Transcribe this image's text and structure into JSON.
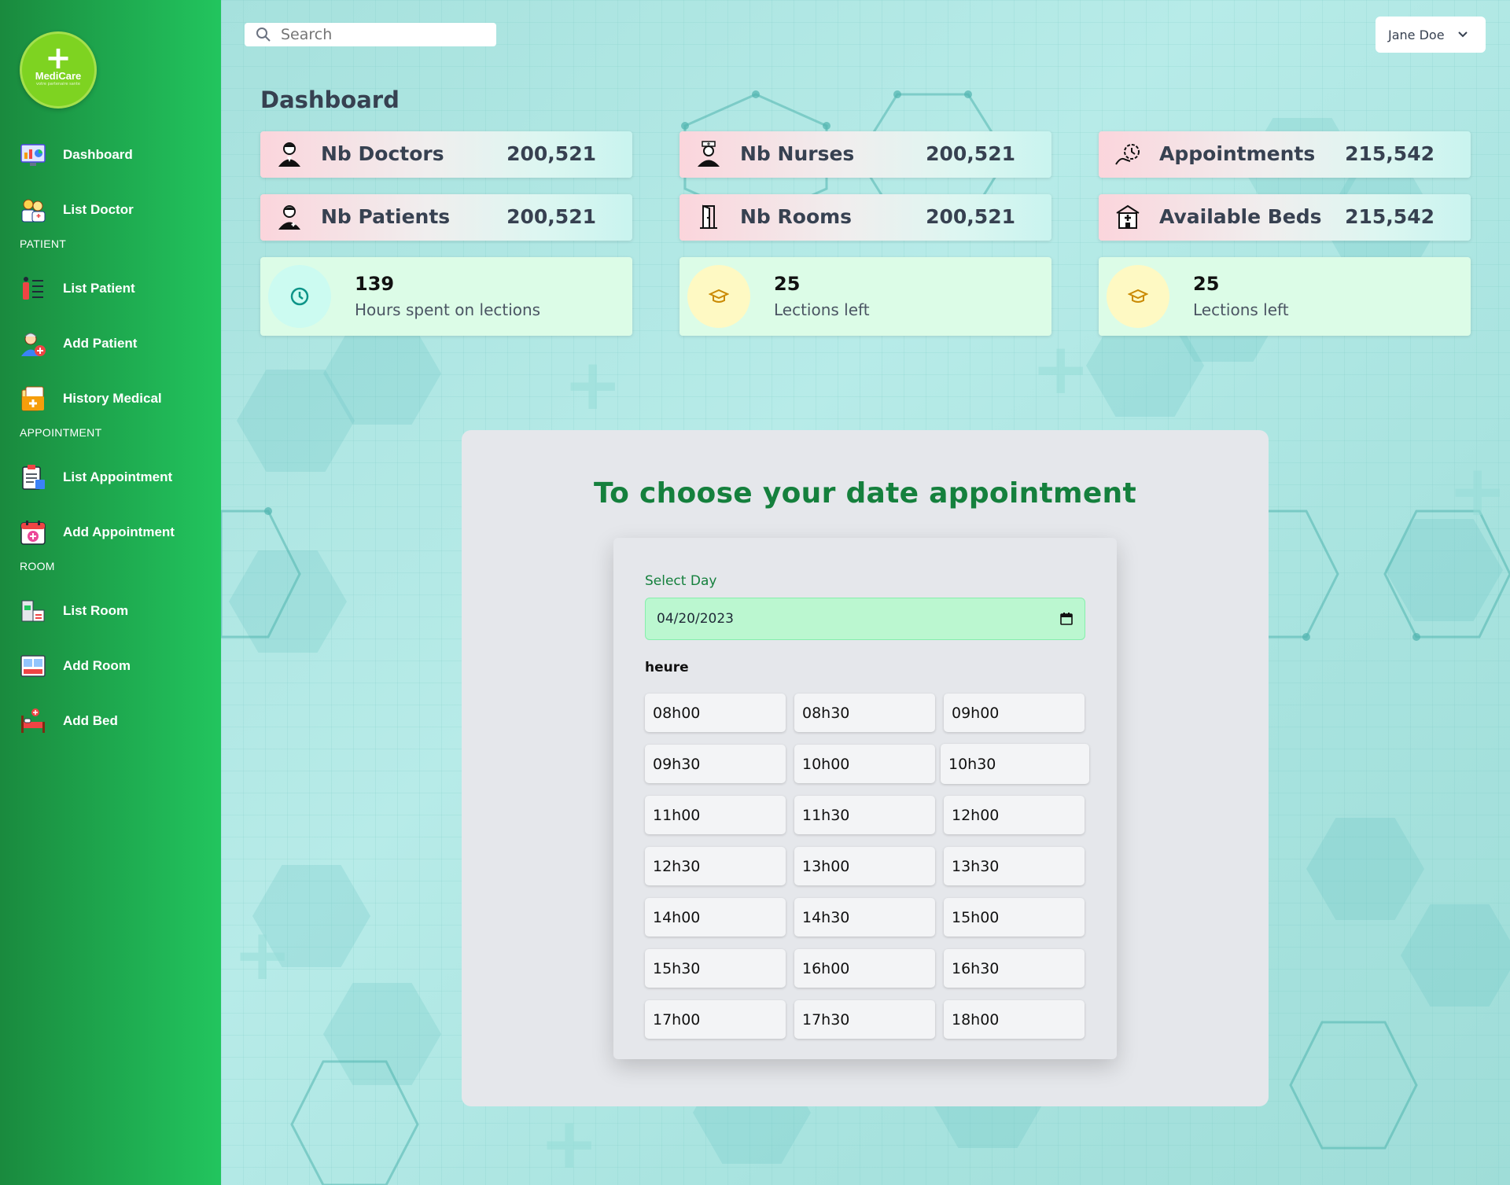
{
  "app": {
    "logo_name": "MediCare",
    "logo_tagline": "votre partenaire sante"
  },
  "sidebar": {
    "items": [
      {
        "label": "Dashboard",
        "icon": "dashboard-icon"
      },
      {
        "label": "List Doctor",
        "icon": "doctors-icon"
      },
      {
        "section": "PATIENT"
      },
      {
        "label": "List Patient",
        "icon": "list-patient-icon"
      },
      {
        "label": "Add Patient",
        "icon": "add-patient-icon"
      },
      {
        "label": "History Medical",
        "icon": "medical-folder-icon"
      },
      {
        "section": "APPOINTMENT"
      },
      {
        "label": "List Appointment",
        "icon": "clipboard-icon"
      },
      {
        "label": "Add Appointment",
        "icon": "calendar-add-icon"
      },
      {
        "section": "ROOM"
      },
      {
        "label": "List Room",
        "icon": "room-icon"
      },
      {
        "label": "Add Room",
        "icon": "add-room-icon"
      },
      {
        "label": "Add Bed",
        "icon": "bed-icon"
      }
    ]
  },
  "header": {
    "search_placeholder": "Search",
    "user_name": "Jane Doe"
  },
  "page_title": "Dashboard",
  "stats": [
    {
      "label": "Nb Doctors",
      "value": "200,521",
      "icon": "doctor-icon"
    },
    {
      "label": "Nb Nurses",
      "value": "200,521",
      "icon": "nurse-icon"
    },
    {
      "label": "Appointments",
      "value": "215,542",
      "icon": "appointment-icon"
    },
    {
      "label": "Nb Patients",
      "value": "200,521",
      "icon": "patient-icon"
    },
    {
      "label": "Nb Rooms",
      "value": "200,521",
      "icon": "door-icon"
    },
    {
      "label": "Available Beds",
      "value": "215,542",
      "icon": "hospital-icon"
    }
  ],
  "info_cards": [
    {
      "number": "139",
      "text": "Hours spent on lections",
      "icon": "clock-icon",
      "color": "#ccfbf1"
    },
    {
      "number": "25",
      "text": "Lections left",
      "icon": "graduation-cap-icon",
      "color": "#fef9c3"
    },
    {
      "number": "25",
      "text": "Lections left",
      "icon": "graduation-cap-icon",
      "color": "#fef9c3"
    }
  ],
  "appointment": {
    "title": "To choose your date appointment",
    "day_label": "Select Day",
    "date_value": "04/20/2023",
    "hour_label": "heure",
    "slots": [
      "08h00",
      "08h30",
      "09h00",
      "09h30",
      "10h00",
      "10h30",
      "11h00",
      "11h30",
      "12h00",
      "12h30",
      "13h00",
      "13h30",
      "14h00",
      "14h30",
      "15h00",
      "15h30",
      "16h00",
      "16h30",
      "17h00",
      "17h30",
      "18h00"
    ],
    "highlighted_slot": "10h30"
  },
  "colors": {
    "sidebar_dark": "#1a8a3e",
    "sidebar_light": "#22c55e",
    "accent_green": "#15803d",
    "date_bg": "#bbf7d0"
  }
}
